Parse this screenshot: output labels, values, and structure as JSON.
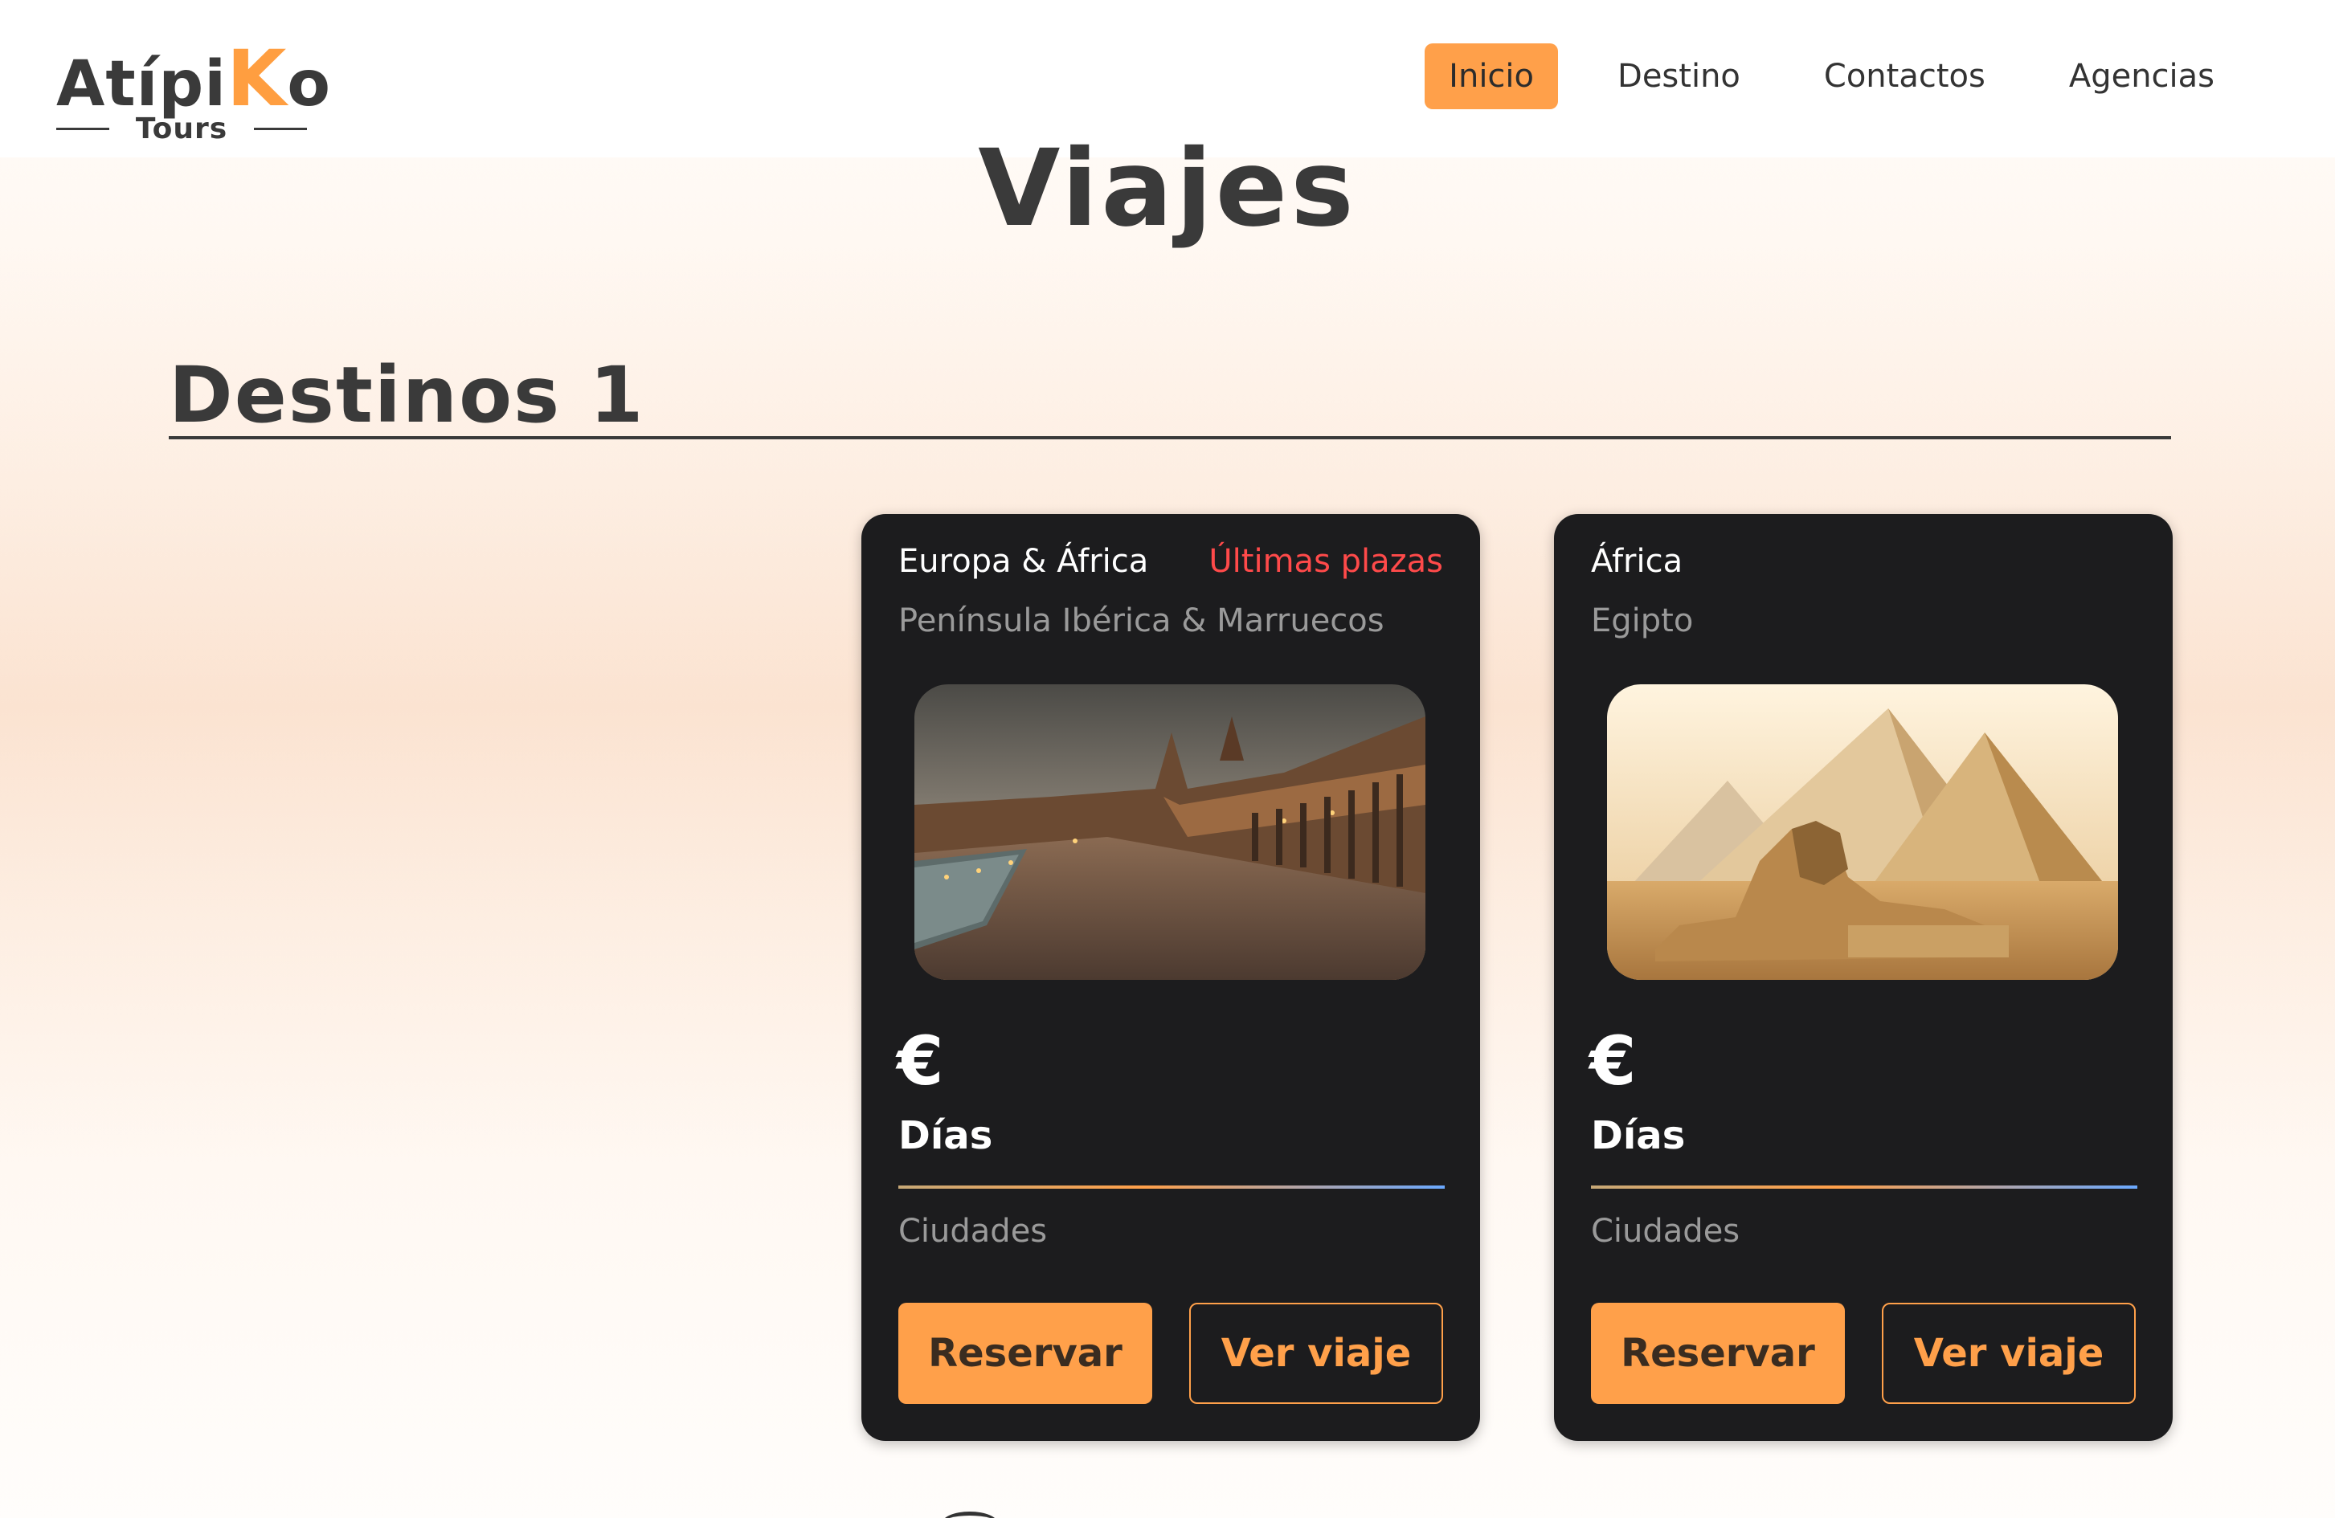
{
  "brand": {
    "name_part1": "Atípi",
    "name_k": "K",
    "name_part2": "o",
    "sub": "Tours",
    "accent": "#ffa04a"
  },
  "nav": {
    "items": [
      {
        "label": "Inicio",
        "active": true
      },
      {
        "label": "Destino"
      },
      {
        "label": "Contactos"
      },
      {
        "label": "Agencias"
      }
    ]
  },
  "page": {
    "title": "Viajes"
  },
  "section": {
    "title": "Destinos 1"
  },
  "cards": [
    {
      "region": "Europa & África",
      "badge": "Últimas plazas",
      "country": "Península Ibérica  & Marruecos",
      "image_icon": "plaza-espana-image",
      "price_symbol": "€",
      "days_label": "Días",
      "cities_label": "Ciudades",
      "reserve_label": "Reservar",
      "view_label": "Ver viaje"
    },
    {
      "region": "África",
      "country": "Egipto",
      "image_icon": "pyramids-sphinx-image",
      "price_symbol": "€",
      "days_label": "Días",
      "cities_label": "Ciudades",
      "reserve_label": "Reservar",
      "view_label": "Ver viaje"
    }
  ]
}
